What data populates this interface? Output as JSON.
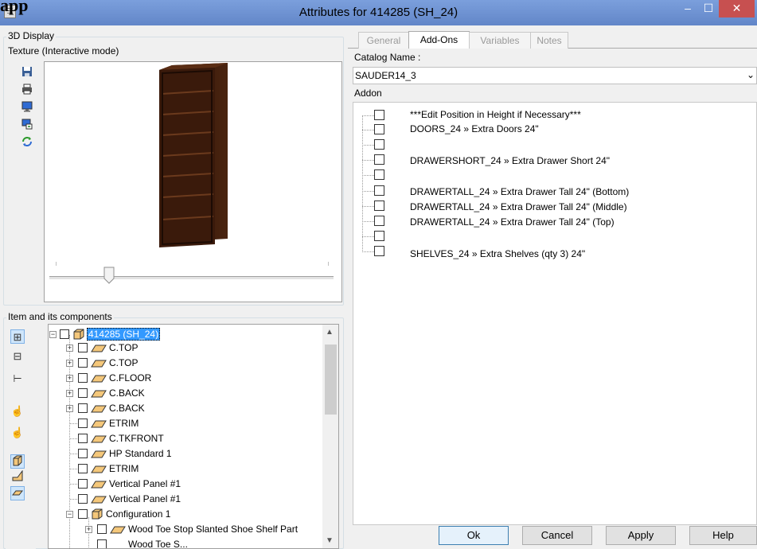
{
  "window": {
    "title": "Attributes for 414285 (SH_24)",
    "bleed_text": "app",
    "minimize_label": "–",
    "maximize_label": "☐",
    "close_label": "✕"
  },
  "display3d": {
    "group_label": "3D Display",
    "mode_label": "Texture (Interactive mode)",
    "toolbar": [
      "save-icon",
      "print-icon",
      "monitor-icon",
      "export-icon",
      "refresh-icon"
    ]
  },
  "components": {
    "group_label": "Item and its components",
    "root": "414285 (SH_24)",
    "items": [
      "C.TOP",
      "C.TOP",
      "C.FLOOR",
      "C.BACK",
      "C.BACK",
      "ETRIM",
      "C.TKFRONT",
      "HP Standard 1",
      "ETRIM",
      "Vertical Panel #1",
      "Vertical Panel #1",
      "Configuration 1",
      "Wood Toe Stop Slanted Shoe Shelf Part",
      "Wood Toe S..."
    ]
  },
  "tabs": [
    {
      "label": "General"
    },
    {
      "label": "Add-Ons"
    },
    {
      "label": "Variables"
    },
    {
      "label": "Notes"
    }
  ],
  "catalog": {
    "label": "Catalog Name :",
    "value": "SAUDER14_3",
    "addon_label": "Addon"
  },
  "addons": [
    "***Edit Position in Height if Necessary***",
    "DOORS_24 » Extra Doors 24\"",
    "",
    "DRAWERSHORT_24 » Extra Drawer Short 24\"",
    "",
    "DRAWERTALL_24 » Extra Drawer Tall 24\" (Bottom)",
    "DRAWERTALL_24 » Extra Drawer Tall 24\" (Middle)",
    "DRAWERTALL_24 » Extra Drawer Tall 24\" (Top)",
    "",
    "SHELVES_24 » Extra Shelves (qty 3) 24\""
  ],
  "buttons": {
    "ok": "Ok",
    "cancel": "Cancel",
    "apply": "Apply",
    "help": "Help"
  },
  "colors": {
    "titlebar": "#6a8fd0",
    "close": "#c75050",
    "selection": "#3399ff",
    "wood": "#3d1c0a"
  }
}
